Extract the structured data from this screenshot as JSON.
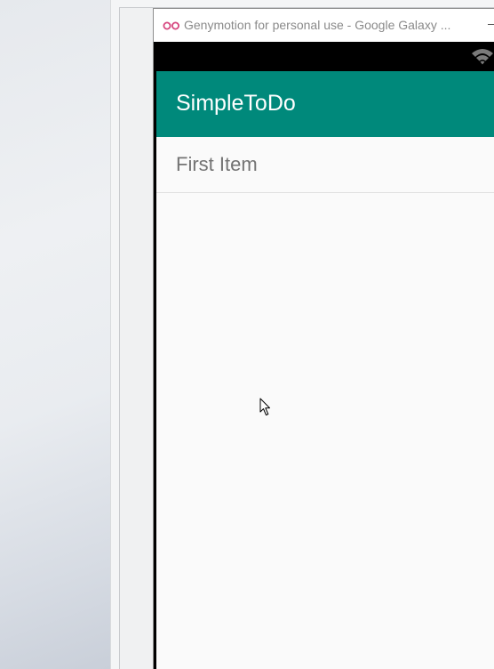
{
  "emulator_window": {
    "title": "Genymotion for personal use - Google Galaxy ...",
    "logo_icon": "genymotion-logo-icon",
    "minimize_icon": "minimize-icon"
  },
  "status_bar": {
    "icons": [
      "wifi-icon"
    ]
  },
  "app": {
    "title": "SimpleToDo",
    "accent_color": "#00897b"
  },
  "todo_list": {
    "items": [
      "First Item"
    ]
  }
}
